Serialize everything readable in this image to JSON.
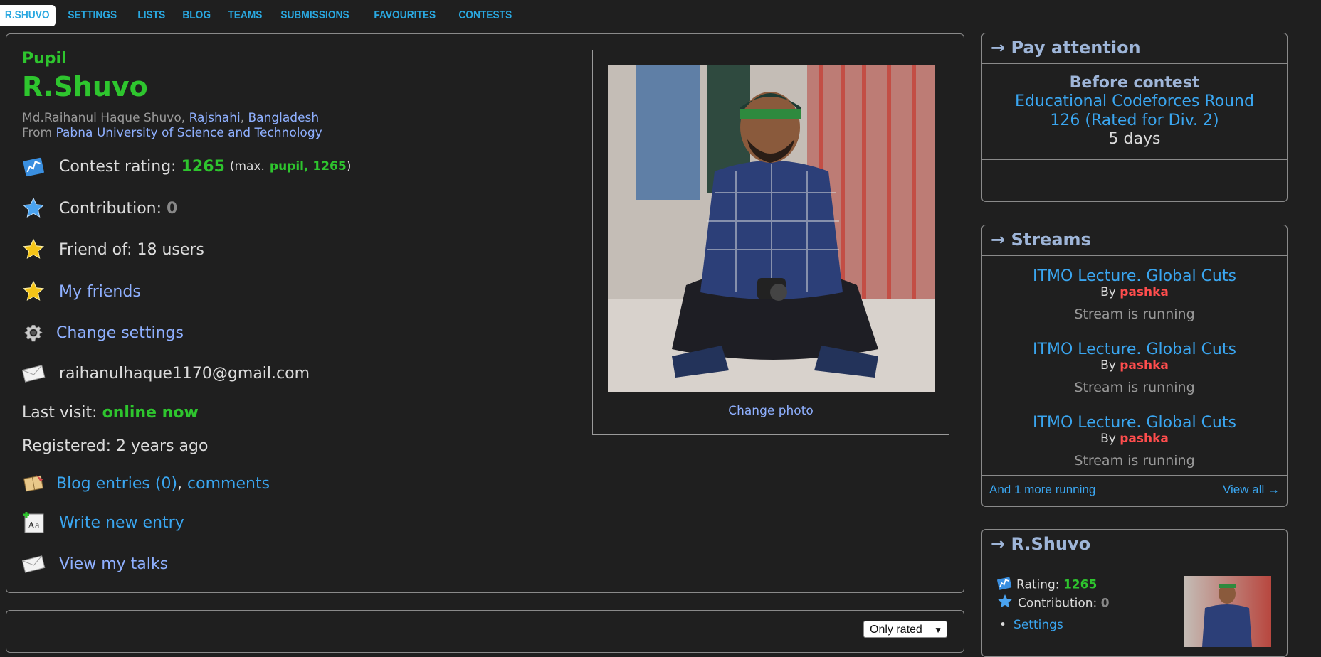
{
  "tabs": [
    "R.SHUVO",
    "SETTINGS",
    "LISTS",
    "BLOG",
    "TEAMS",
    "SUBMISSIONS",
    "FAVOURITES",
    "CONTESTS"
  ],
  "profile": {
    "rank": "Pupil",
    "handle": "R.Shuvo",
    "name": "Md.Raihanul Haque Shuvo",
    "city": "Rajshahi",
    "country": "Bangladesh",
    "from_label": "From",
    "organization": "Pabna University of Science and Technology",
    "contest_rating_label": "Contest rating:",
    "rating": "1265",
    "max_prefix": "(max.",
    "max_rank": "pupil, 1265",
    "max_suffix": ")",
    "contribution_label": "Contribution:",
    "contribution": "0",
    "friend_of": "Friend of: 18 users",
    "my_friends": "My friends",
    "change_settings": "Change settings",
    "email": "raihanulhaque1170@gmail.com",
    "last_visit_label": "Last visit:",
    "last_visit": "online now",
    "registered": "Registered: 2 years ago",
    "blog_entries": "Blog entries (0)",
    "comments": "comments",
    "write_entry": "Write new entry",
    "view_talks": "View my talks",
    "change_photo": "Change photo"
  },
  "filter": {
    "selected": "Only rated"
  },
  "pay_attention": {
    "title": "→ Pay attention",
    "before": "Before contest",
    "contest": "Educational Codeforces Round 126 (Rated for Div. 2)",
    "countdown": "5 days"
  },
  "streams": {
    "title": "→ Streams",
    "items": [
      {
        "title": "ITMO Lecture. Global Cuts",
        "by": "By",
        "author": "pashka",
        "status": "Stream is running"
      },
      {
        "title": "ITMO Lecture. Global Cuts",
        "by": "By",
        "author": "pashka",
        "status": "Stream is running"
      },
      {
        "title": "ITMO Lecture. Global Cuts",
        "by": "By",
        "author": "pashka",
        "status": "Stream is running"
      }
    ],
    "more": "And 1 more running",
    "view_all": "View all →"
  },
  "user_box": {
    "title": "→ R.Shuvo",
    "rating_label": "Rating:",
    "rating": "1265",
    "contribution_label": "Contribution:",
    "contribution": "0",
    "settings": "Settings"
  },
  "colors": {
    "rank_green": "#2ec52e",
    "link": "#8fb0ff",
    "accent_blue": "#3aa6f0",
    "author_red": "#ff4d4d"
  }
}
